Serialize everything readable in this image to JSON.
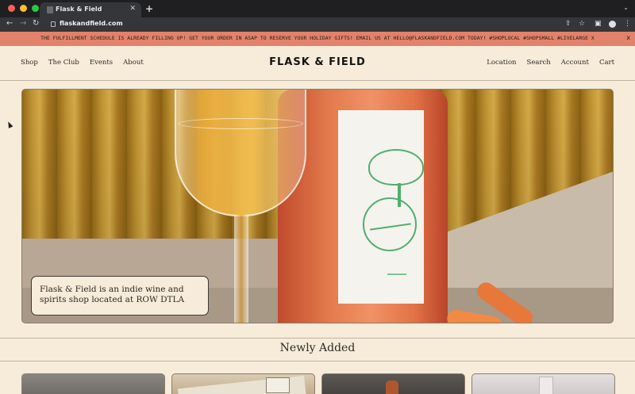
{
  "browser": {
    "tab_title": "Flask & Field",
    "tab_close": "✕",
    "new_tab": "+",
    "tab_menu": "⌄",
    "url": "flaskandfield.com",
    "icons": [
      "back-icon",
      "forward-icon",
      "reload-icon",
      "lock-icon",
      "share-icon",
      "bookmark-star-icon",
      "side-panel-icon",
      "profile-icon",
      "kebab-menu-icon"
    ],
    "traffic_lights": [
      "#ff5f57",
      "#febc2e",
      "#28c840"
    ]
  },
  "banner": {
    "text": "THE FULFILLMENT SCHEDULE IS ALREADY FILLING UP! GET YOUR ORDER IN ASAP TO RESERVE YOUR HOLIDAY GIFTS! EMAIL US AT HELLO@FLASKANDFIELD.COM TODAY! #SHOPLOCAL #SHOPSMALL #LIVELARGE X",
    "close": "x",
    "color": "#e2826a"
  },
  "header": {
    "logo": "FLASK & FIELD",
    "nav_left": [
      "Shop",
      "The Club",
      "Events",
      "About"
    ],
    "nav_right": [
      "Location",
      "Search",
      "Account",
      "Cart"
    ]
  },
  "hero": {
    "caption": "Flask & Field is an indie wine and spirits shop located at ROW DTLA"
  },
  "newly_added": {
    "title": "Newly Added",
    "products": [
      "product-1",
      "product-2",
      "product-3",
      "product-4"
    ]
  }
}
